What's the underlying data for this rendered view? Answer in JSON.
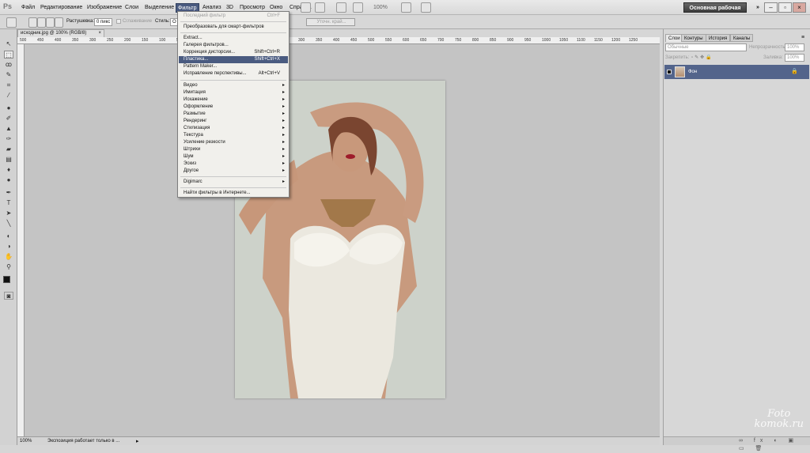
{
  "menubar": {
    "logo": "Ps",
    "items": [
      "Файл",
      "Редактирование",
      "Изображение",
      "Слои",
      "Выделение",
      "Фильтр",
      "Анализ",
      "3D",
      "Просмотр",
      "Окно",
      "Справка"
    ],
    "zoom": "100%",
    "workspace": "Основная рабочая среда",
    "more": "»"
  },
  "options": {
    "feather_label": "Растушевка:",
    "feather_value": "0 пикс",
    "antialias": "Сглаживание",
    "style_label": "Стиль:",
    "style_value": "О",
    "refine": "Уточн. край..."
  },
  "document": {
    "tab_title": "исходник.jpg @ 100% (RGB/8)",
    "tab_close": "×",
    "ruler_marks": [
      "500",
      "450",
      "400",
      "350",
      "300",
      "250",
      "200",
      "150",
      "100",
      "50",
      "0",
      "50",
      "100",
      "150",
      "200",
      "250",
      "300",
      "350",
      "400",
      "450",
      "500",
      "550",
      "600",
      "650",
      "700",
      "750",
      "800",
      "850",
      "900",
      "950",
      "1000",
      "1050",
      "1100",
      "1150",
      "1200",
      "1250"
    ],
    "status_zoom": "100%",
    "status_text": "Экспозиция работает только в ..."
  },
  "filter_menu": {
    "last_filter": {
      "label": "Последний фильтр",
      "shortcut": "Ctrl+F"
    },
    "smart": "Преобразовать для смарт-фильтров",
    "group1": [
      {
        "label": "Extract...",
        "shortcut": ""
      },
      {
        "label": "Галерея фильтров...",
        "shortcut": ""
      },
      {
        "label": "Коррекция дисторсии...",
        "shortcut": "Shift+Ctrl+R"
      },
      {
        "label": "Пластика...",
        "shortcut": "Shift+Ctrl+X"
      },
      {
        "label": "Pattern Maker...",
        "shortcut": ""
      },
      {
        "label": "Исправление перспективы...",
        "shortcut": "Alt+Ctrl+V"
      }
    ],
    "group2": [
      "Видео",
      "Имитация",
      "Искажение",
      "Оформление",
      "Размытие",
      "Рендеринг",
      "Стилизация",
      "Текстура",
      "Усиление резкости",
      "Штрихи",
      "Шум",
      "Эскиз",
      "Другое"
    ],
    "digimarc": "Digimarc",
    "online": "Найти фильтры в Интернете...",
    "submenu_arrow": "▸"
  },
  "panels": {
    "tabs": [
      "Слои",
      "Контуры",
      "История",
      "Каналы"
    ],
    "blend_mode": "Обычные",
    "opacity_label": "Непрозрачность:",
    "opacity_value": "100%",
    "lock_label": "Закрепить:",
    "fill_label": "Заливка:",
    "fill_value": "100%",
    "layer_name": "Фон"
  },
  "watermark": {
    "line1": "Foto",
    "line2": "komok.ru"
  },
  "colors": {
    "accent": "#4a5b80",
    "menu_bg": "#f1f0ec",
    "workspace_bg": "#c4c4c4"
  }
}
